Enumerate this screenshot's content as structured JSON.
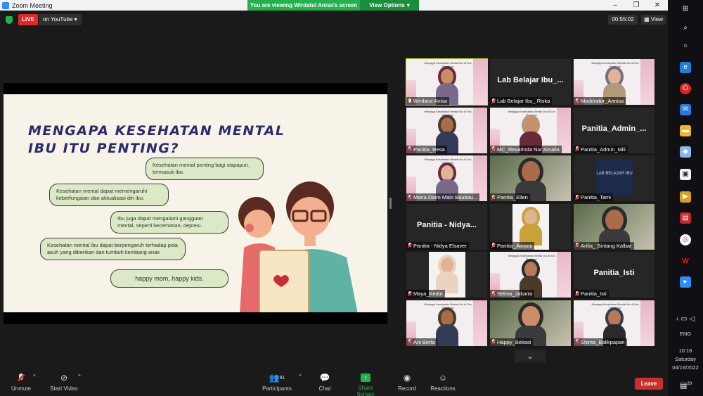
{
  "window": {
    "title": "Zoom Meeting",
    "controls": [
      "–",
      "❐",
      "✕"
    ]
  },
  "banner": {
    "message": "You are viewing Wirdatul Anisa's screen",
    "view_options": "View Options"
  },
  "meeting": {
    "live_badge": "LIVE",
    "live_dest": "on YouTube",
    "timer": "00:55:02",
    "view_label": "View"
  },
  "slide": {
    "title": "MENGAPA KESEHATAN MENTAL IBU ITU PENTING?",
    "bubbles": [
      "Kesehatan mental penting bagi siapapun, termasuk ibu.",
      "Kesehatan mental dapat memengaruhi keberfungsian dan aktualisasi diri ibu.",
      "Ibu juga dapat mengalami gangguan mental, seperti kecemasan, depresi.",
      "Kesehatan mental ibu dapat berpengaruh terhadap pola asuh yang diberikan dan tumbuh kembang anak",
      "happy mom, happy kids."
    ]
  },
  "thumb_text": "Menjaga Kesehatan Mental Ibu di Era Pandemi",
  "lab_logo_text": "LAB BELAJAR IBU",
  "participants": [
    {
      "name": "Wirdatul Anisa",
      "kind": "slide",
      "mic": "on",
      "active": true
    },
    {
      "name": "Lab Belajar Ibu_ Riska",
      "kind": "name",
      "big": "Lab Belajar Ibu_...",
      "mic": "off"
    },
    {
      "name": "Moderator_Annisa",
      "kind": "slide",
      "mic": "off"
    },
    {
      "name": "Panitia_Resa",
      "kind": "slide",
      "mic": "off"
    },
    {
      "name": "MC_Revarinda Nur Amalia",
      "kind": "slide",
      "mic": "off"
    },
    {
      "name": "Panitia_Admin_Mili",
      "kind": "name",
      "big": "Panitia_Admin_...",
      "mic": "off"
    },
    {
      "name": "Maria Dairo Malo Baubau...",
      "kind": "slide",
      "mic": "off"
    },
    {
      "name": "Panitia_Ellen",
      "kind": "cam",
      "mic": "off"
    },
    {
      "name": "Panitia_Tami",
      "kind": "logo",
      "mic": "off"
    },
    {
      "name": "Panitia - Nidya Elsaver",
      "kind": "name",
      "big": "Panitia - Nidya...",
      "mic": "off"
    },
    {
      "name": "Panitia_Aimom",
      "kind": "photo",
      "mic": "off"
    },
    {
      "name": "Arifia_ Sintang Kalbar",
      "kind": "cam",
      "mic": "off"
    },
    {
      "name": "Maya_Kediri",
      "kind": "photo",
      "mic": "off"
    },
    {
      "name": "Selma_Jakarta",
      "kind": "slide",
      "mic": "off"
    },
    {
      "name": "Panitia_Isti",
      "kind": "name",
      "big": "Panitia_Isti",
      "mic": "off"
    },
    {
      "name": "Ani Berta",
      "kind": "slide",
      "mic": "off"
    },
    {
      "name": "Happy_Bekasi",
      "kind": "cam",
      "mic": "off"
    },
    {
      "name": "Shinta_Balikpapan",
      "kind": "slide",
      "mic": "off"
    }
  ],
  "toolbar": {
    "unmute": "Unmute",
    "start_video": "Start Video",
    "participants": "Participants",
    "participants_count": "81",
    "chat": "Chat",
    "share_screen": "Share Screen",
    "record": "Record",
    "reactions": "Reactions",
    "leave": "Leave"
  },
  "taskbar": {
    "lang": "ENG",
    "time": "10:16",
    "day": "Saturday",
    "date": "04/16/2022",
    "notifications": "20"
  },
  "colors": {
    "live": "#e02828",
    "banner": "#23b14d",
    "leave": "#c9302c",
    "active_speaker": "#d8e234",
    "slide_title": "#2b2b6b",
    "bubble": "#dce9c6"
  }
}
